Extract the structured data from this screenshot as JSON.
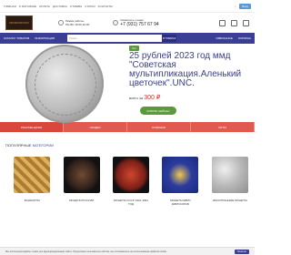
{
  "topbar": {
    "links": [
      "ГЛАВНАЯ",
      "О МАГАЗИНЕ",
      "ОПЛАТА",
      "ДОСТАВКА",
      "ОТЗЫВЫ",
      "СТАТЬИ",
      "КОНТАКТЫ"
    ],
    "wishlist": "♡",
    "login_label": "Вход"
  },
  "header": {
    "logo_text": "MINIMUMCOINS",
    "hours_title": "Режим работы",
    "hours_value": "ПН-ВС 10:00-22:00",
    "phone_title": "Свяжитесь с нами",
    "phone_value": "+7 (931) 757 67 94",
    "right_icons": [
      "user-icon",
      "heart-icon",
      "cart-icon"
    ]
  },
  "nav": {
    "catalog_label": "КАТАЛОГ ТОВАРОВ",
    "info_label": "ИНФОРМАЦИЯ",
    "search_placeholder": "Поиск",
    "search_button": "В ТОВАРАХ",
    "favorites_label": "ИЗБРАННОЕ",
    "cart_label": "КОРЗИНА"
  },
  "hero": {
    "badge": "Хит",
    "title": "25 рублей 2023 год ммд \"Советская мультипликация.Аленький цветочек\".UNC.",
    "price_prefix": "всего за",
    "price_value": "300 ₽",
    "buy_label": "КУПИТЬ СЕЙЧАС"
  },
  "tabs": [
    "РЕКОМЕНДУЕМ",
    "СКИДКИ",
    "НОВИНКИ",
    "ХИТЫ"
  ],
  "categories": {
    "title_prefix": "ПОПУЛЯРНЫЕ",
    "title_accent": "КАТЕГОРИИ",
    "items": [
      {
        "label": "БАНКНОТЫ"
      },
      {
        "label": "МОНЕТЫ РОССИИ"
      },
      {
        "label": "МОНЕТЫ СССР 1921-1991 ГОД"
      },
      {
        "label": "МОНЕТЫ ЕВРО (ЕВРОСОЮЗ)"
      },
      {
        "label": "ИНОСТРАННЫЕ МОНЕТЫ"
      }
    ]
  },
  "cookie": {
    "text": "Мы используем файлы cookie для функционирования сайта. Продолжая пользоваться сайтом, вы соглашаетесь на использование файлов cookie.",
    "ok": "Понятно"
  }
}
